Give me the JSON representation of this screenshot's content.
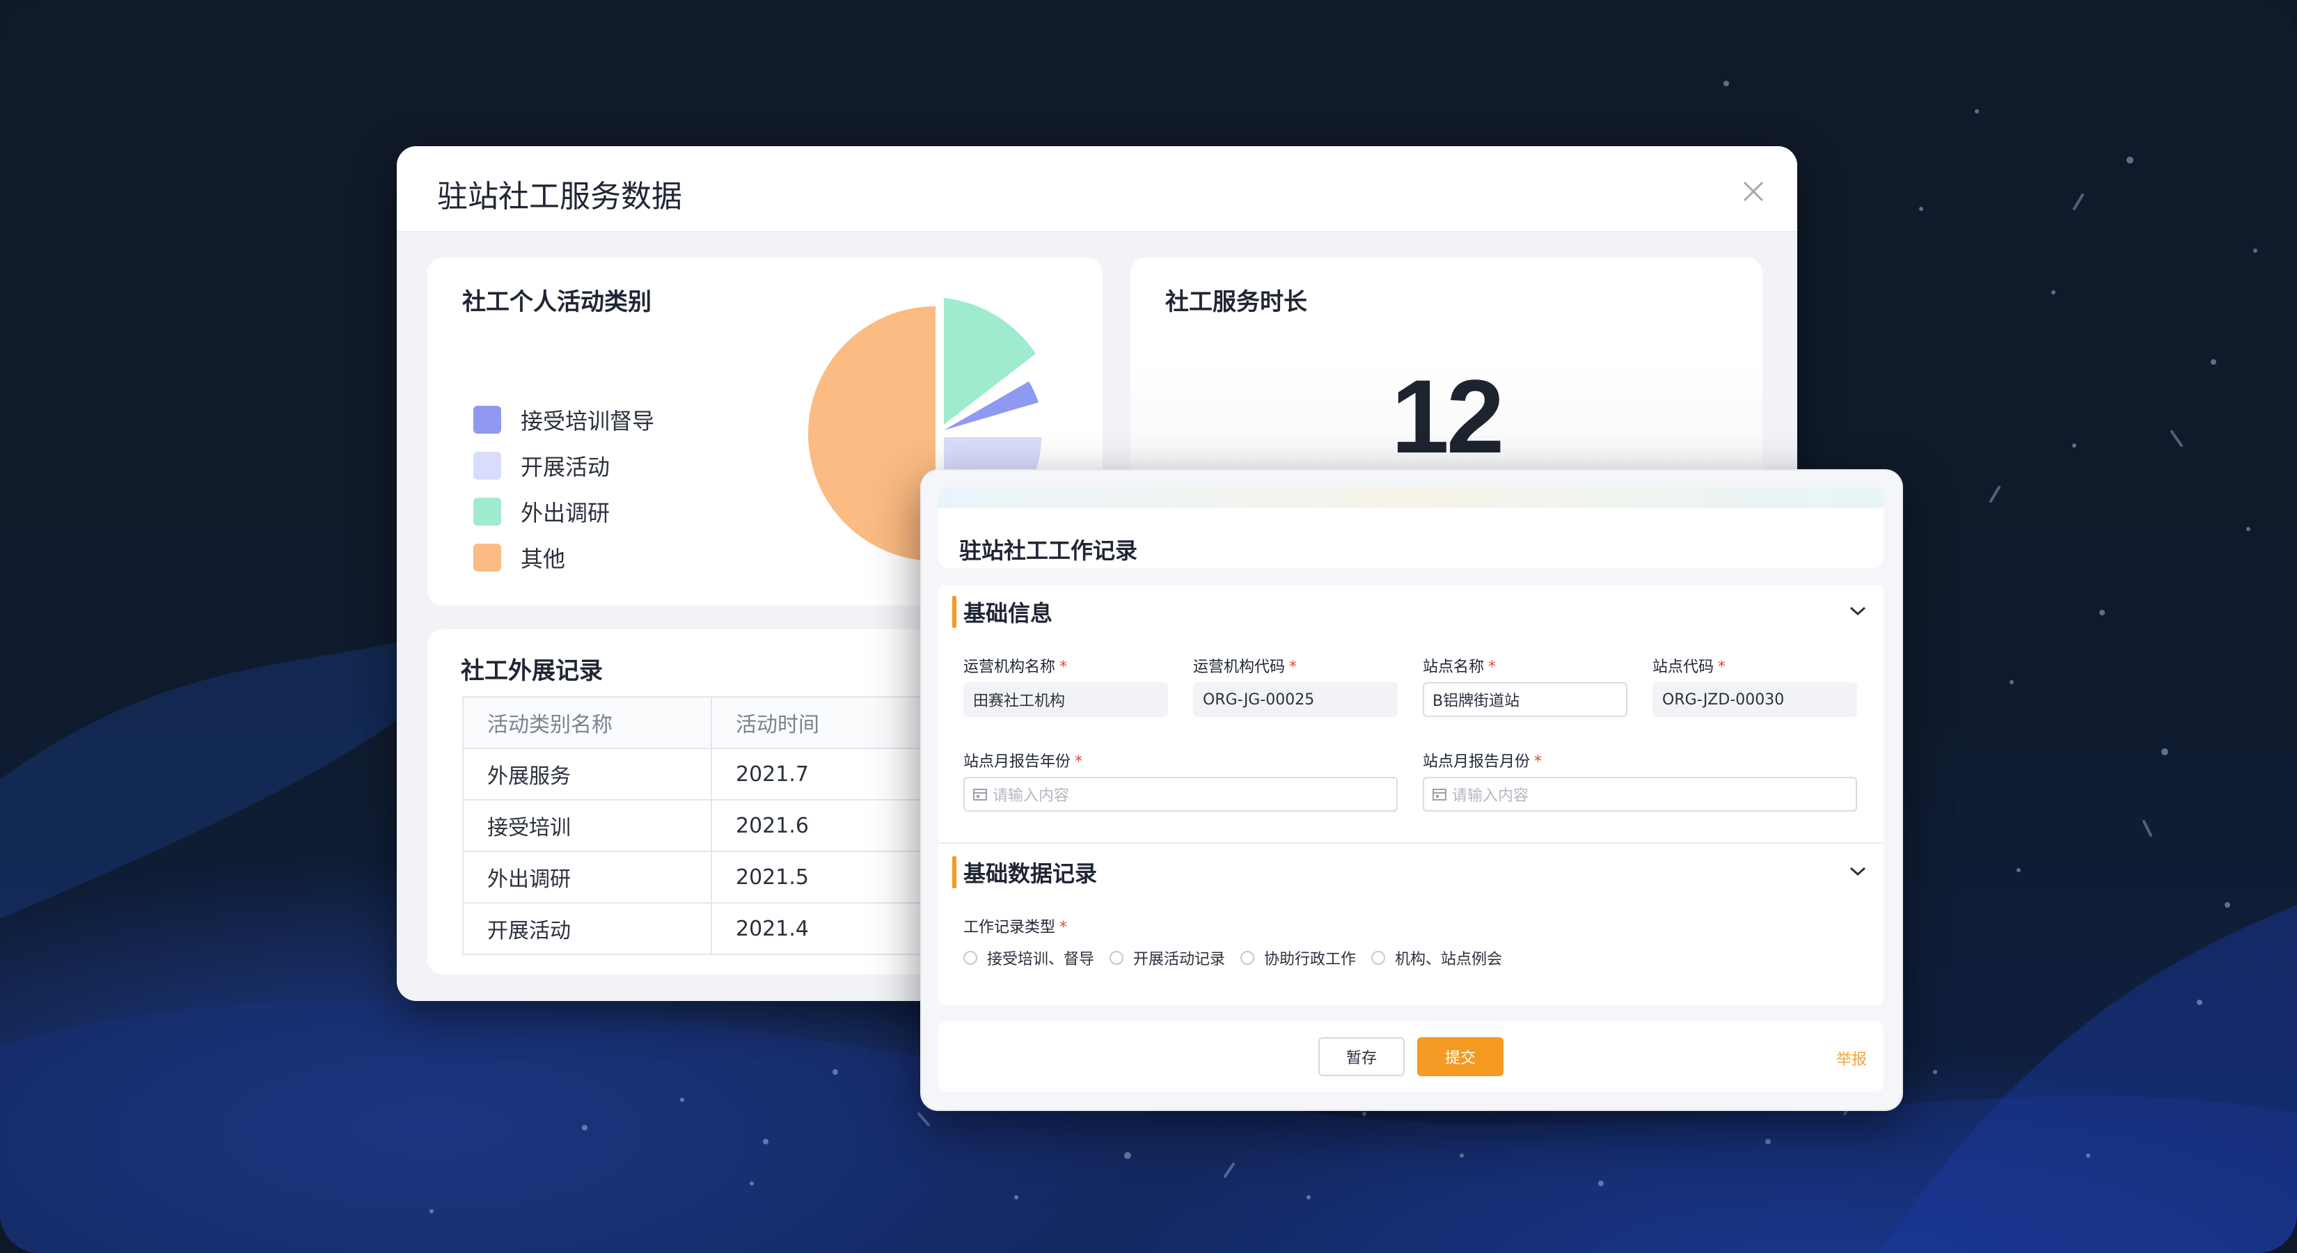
{
  "main": {
    "title": "驻站社工服务数据",
    "activity_card": {
      "title": "社工个人活动类别",
      "legend": [
        {
          "label": "接受培训督导",
          "color": "#8f99f1"
        },
        {
          "label": "开展活动",
          "color": "#d9dcfb"
        },
        {
          "label": "外出调研",
          "color": "#9eebcd"
        },
        {
          "label": "其他",
          "color": "#fbbb82"
        }
      ]
    },
    "duration_card": {
      "title": "社工服务时长",
      "value": "12"
    },
    "records_card": {
      "title": "社工外展记录",
      "columns": [
        "活动类别名称",
        "活动时间"
      ],
      "rows": [
        [
          "外展服务",
          "2021.7"
        ],
        [
          "接受培训",
          "2021.6"
        ],
        [
          "外出调研",
          "2021.5"
        ],
        [
          "开展活动",
          "2021.4"
        ]
      ]
    }
  },
  "modal": {
    "title": "驻站社工工作记录",
    "section_basic": {
      "title": "基础信息",
      "fields": [
        {
          "label": "运营机构名称",
          "value": "田赛社工机构"
        },
        {
          "label": "运营机构代码",
          "value": "ORG-JG-00025"
        },
        {
          "label": "站点名称",
          "value": "B铝牌街道站"
        },
        {
          "label": "站点代码",
          "value": "ORG-JZD-00030"
        }
      ],
      "year_label": "站点月报告年份",
      "year_placeholder": "请输入内容",
      "month_label": "站点月报告月份",
      "month_placeholder": "请输入内容"
    },
    "section_data": {
      "title": "基础数据记录",
      "type_label": "工作记录类型",
      "options": [
        "接受培训、督导",
        "开展活动记录",
        "协助行政工作",
        "机构、站点例会"
      ]
    },
    "required_mark": "*",
    "buttons": {
      "draft": "暂存",
      "submit": "提交",
      "report": "举报"
    },
    "accent": "#f59a23"
  }
}
